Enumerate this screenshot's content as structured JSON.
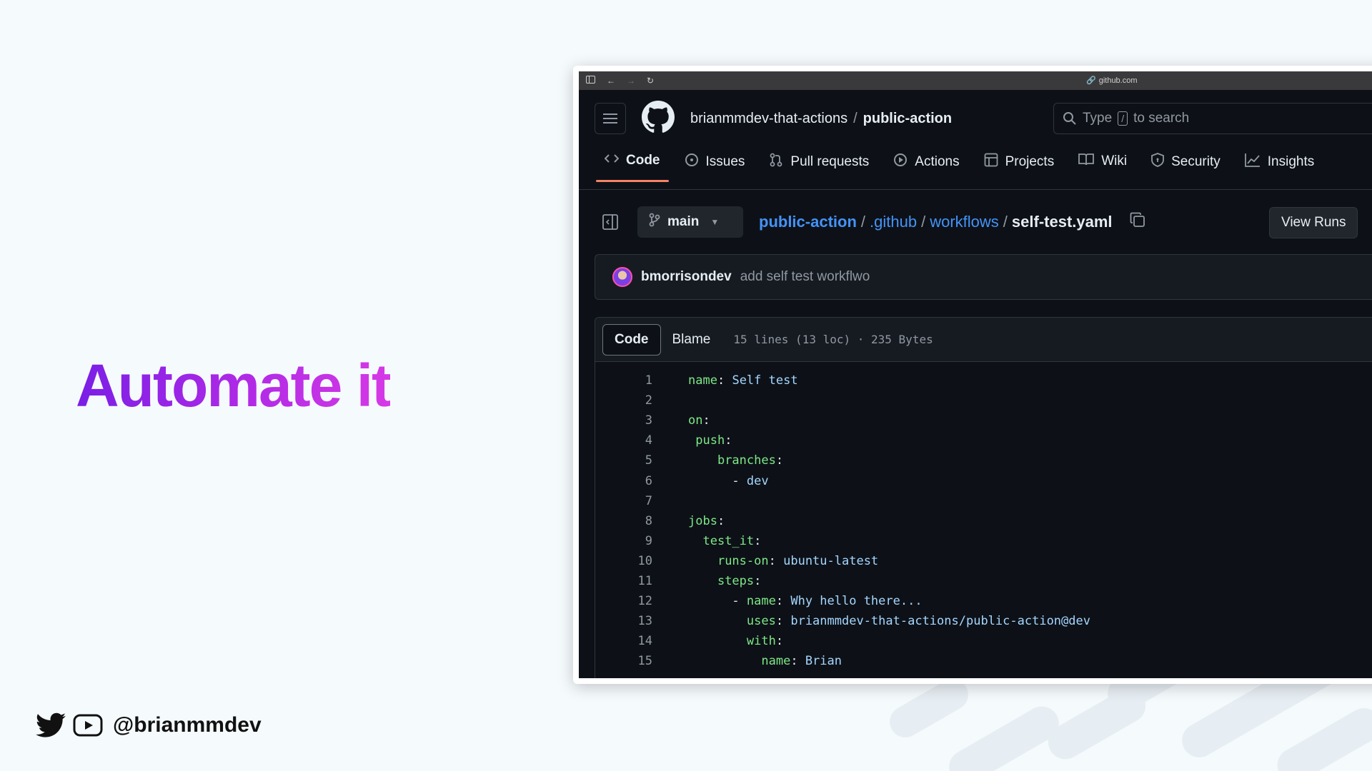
{
  "slide": {
    "title": "Automate it",
    "handle": "@brianmmdev"
  },
  "browser": {
    "url": "github.com"
  },
  "header": {
    "owner": "brianmmdev-that-actions",
    "separator": "/",
    "repo": "public-action",
    "search_prefix": "Type",
    "search_key": "/",
    "search_suffix": "to search"
  },
  "tabs": [
    {
      "label": "Code",
      "icon": "code-icon",
      "active": true
    },
    {
      "label": "Issues",
      "icon": "issue-icon"
    },
    {
      "label": "Pull requests",
      "icon": "pull-request-icon"
    },
    {
      "label": "Actions",
      "icon": "play-icon"
    },
    {
      "label": "Projects",
      "icon": "table-icon"
    },
    {
      "label": "Wiki",
      "icon": "book-icon"
    },
    {
      "label": "Security",
      "icon": "shield-icon"
    },
    {
      "label": "Insights",
      "icon": "graph-icon"
    }
  ],
  "file_bar": {
    "branch": "main",
    "crumbs": [
      "public-action",
      ".github",
      "workflows"
    ],
    "file": "self-test.yaml",
    "slash": "/",
    "view_runs": "View Runs"
  },
  "commit": {
    "author": "bmorrisondev",
    "message": "add self test workflwo"
  },
  "code_view": {
    "tab_code": "Code",
    "tab_blame": "Blame",
    "info": "15 lines (13 loc) · 235 Bytes"
  },
  "code": [
    {
      "n": "1",
      "indent": "",
      "key": "name",
      "val": "Self test"
    },
    {
      "n": "2",
      "indent": "",
      "key": "",
      "val": ""
    },
    {
      "n": "3",
      "indent": "",
      "key": "on",
      "val": ""
    },
    {
      "n": "4",
      "indent": " ",
      "key": "push",
      "val": ""
    },
    {
      "n": "5",
      "indent": "    ",
      "key": "branches",
      "val": ""
    },
    {
      "n": "6",
      "indent": "      - ",
      "key": "",
      "val": "dev"
    },
    {
      "n": "7",
      "indent": "",
      "key": "",
      "val": ""
    },
    {
      "n": "8",
      "indent": "",
      "key": "jobs",
      "val": ""
    },
    {
      "n": "9",
      "indent": "  ",
      "key": "test_it",
      "val": ""
    },
    {
      "n": "10",
      "indent": "    ",
      "key": "runs-on",
      "val": "ubuntu-latest"
    },
    {
      "n": "11",
      "indent": "    ",
      "key": "steps",
      "val": ""
    },
    {
      "n": "12",
      "indent": "      - ",
      "key": "name",
      "val": "Why hello there..."
    },
    {
      "n": "13",
      "indent": "        ",
      "key": "uses",
      "val": "brianmmdev-that-actions/public-action@dev"
    },
    {
      "n": "14",
      "indent": "        ",
      "key": "with",
      "val": ""
    },
    {
      "n": "15",
      "indent": "          ",
      "key": "name",
      "val": "Brian"
    }
  ],
  "colors": {
    "accent_tab": "#f78166",
    "link": "#4493f8",
    "yaml_key": "#7ee787",
    "yaml_value": "#a5d6ff",
    "title_gradient_start": "#7a1ee6",
    "title_gradient_end": "#d639e6"
  }
}
